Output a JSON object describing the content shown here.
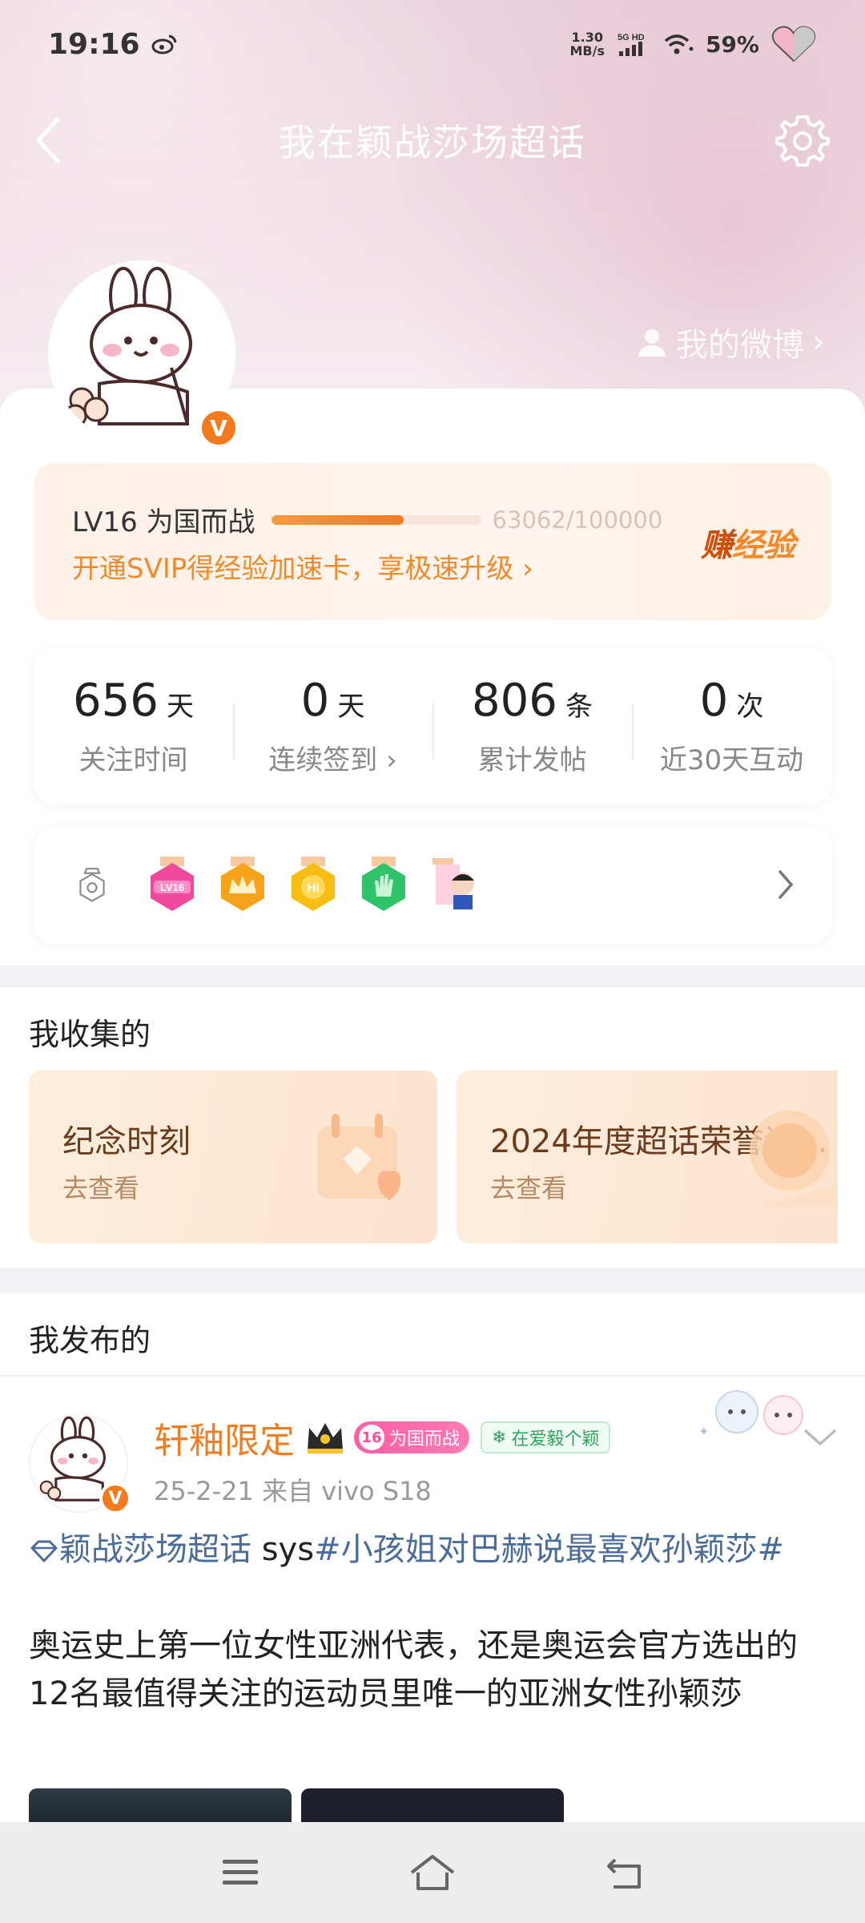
{
  "status_bar": {
    "time": "19:16",
    "net_speed_value": "1.30",
    "net_speed_unit": "MB/s",
    "signal": "5G HD",
    "battery": "59%"
  },
  "header": {
    "title": "我在颖战莎场超话",
    "my_weibo": "我的微博"
  },
  "level": {
    "label": "LV16 为国而战",
    "exp": "63062/100000",
    "progress": 0.63,
    "promo": "开通SVIP得经验加速卡，享极速升级 ›",
    "earn_prefix": "赚",
    "earn_suffix": "经验"
  },
  "stats": [
    {
      "value": "656",
      "unit": "天",
      "label": "关注时间"
    },
    {
      "value": "0",
      "unit": "天",
      "label": "连续签到 ›"
    },
    {
      "value": "806",
      "unit": "条",
      "label": "累计发帖"
    },
    {
      "value": "0",
      "unit": "次",
      "label": "近30天互动"
    }
  ],
  "badges": {
    "first_badge_text": "LV16",
    "third_badge_text": "Hi"
  },
  "collection": {
    "title": "我收集的",
    "cards": [
      {
        "title": "纪念时刻",
        "action": "去查看"
      },
      {
        "title": "2024年度超话荣誉证…",
        "action": "去查看"
      }
    ]
  },
  "posts_section": {
    "title": "我发布的",
    "post": {
      "username": "轩釉限定",
      "level_num": "16",
      "level_tag": "为国而战",
      "fan_tag": "在爱毅个颖",
      "meta": "25-2-21  来自 vivo S18",
      "topic_link": "颖战莎场超话",
      "topic_mid": " sys",
      "hashtag": "#小孩姐对巴赫说最喜欢孙颖莎#",
      "body": "奥运史上第一位女性亚洲代表，还是奥运会官方选出的12名最值得关注的运动员里唯一的亚洲女性孙颖莎"
    }
  },
  "colors": {
    "accent_orange": "#f07d22",
    "link_blue": "#4a6c9a",
    "header_pink": "#ead2dc"
  }
}
